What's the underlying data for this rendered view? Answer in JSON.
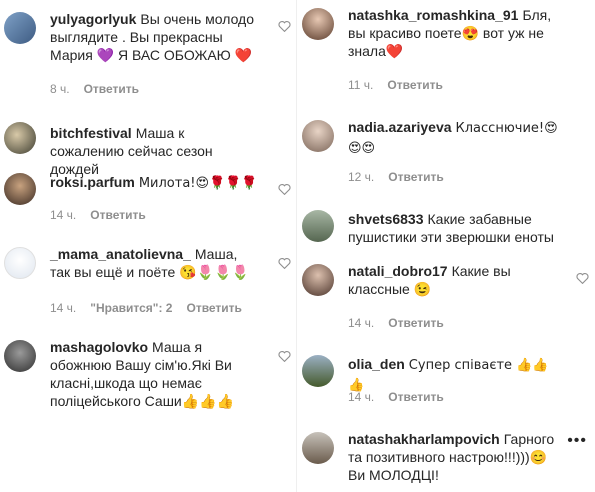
{
  "left": [
    {
      "user": "yulyagorlyuk",
      "text": "Вы очень молодо выглядите . Вы прекрасны Мария 💜 Я ВАС ОБОЖАЮ ❤️",
      "time": "8 ч.",
      "reply": "Ответить"
    },
    {
      "user": "bitchfestival",
      "text": "Маша к сожалению сейчас сезон дождей",
      "time": "",
      "reply": ""
    },
    {
      "user": "roksi.parfum",
      "text": "Милота!😍🌹🌹🌹",
      "time": "14 ч.",
      "reply": "Ответить"
    },
    {
      "user": "_mama_anatolievna_",
      "text": "Маша, так вы ещё и поёте 😘🌷🌷🌷",
      "time": "14 ч.",
      "likes": "\"Нравится\": 2",
      "reply": "Ответить"
    },
    {
      "user": "mashagolovko",
      "text": "Маша я обожнюю Вашу сім'ю.Які Ви класні,шкода що немає поліцейського Саши👍👍👍",
      "time": "",
      "reply": ""
    }
  ],
  "right": [
    {
      "user": "natashka_romashkina_91",
      "text": "Бля, вы красиво поете😍 вот уж не знала❤️",
      "time": "11 ч.",
      "reply": "Ответить"
    },
    {
      "user": "nadia.azariyeva",
      "text": "Класснючие!😍😍😍",
      "time": "12 ч.",
      "reply": "Ответить"
    },
    {
      "user": "shvets6833",
      "text": "Какие забавные пушистики эти зверюшки еноты",
      "time": "",
      "reply": ""
    },
    {
      "user": "natali_dobro17",
      "text": "Какие вы классные 😉",
      "time": "14 ч.",
      "reply": "Ответить"
    },
    {
      "user": "olia_den",
      "text": "Супер співаєте 👍👍👍",
      "time": "14 ч.",
      "reply": "Ответить"
    },
    {
      "user": "natashakharlampovich",
      "text": "Гарного та позитивного настрою!!!)))😊 Ви МОЛОДЦІ!",
      "time": "",
      "reply": ""
    }
  ],
  "more_icon": "•••",
  "icons": {
    "like": "heart-outline-icon",
    "more": "more-options-icon"
  }
}
